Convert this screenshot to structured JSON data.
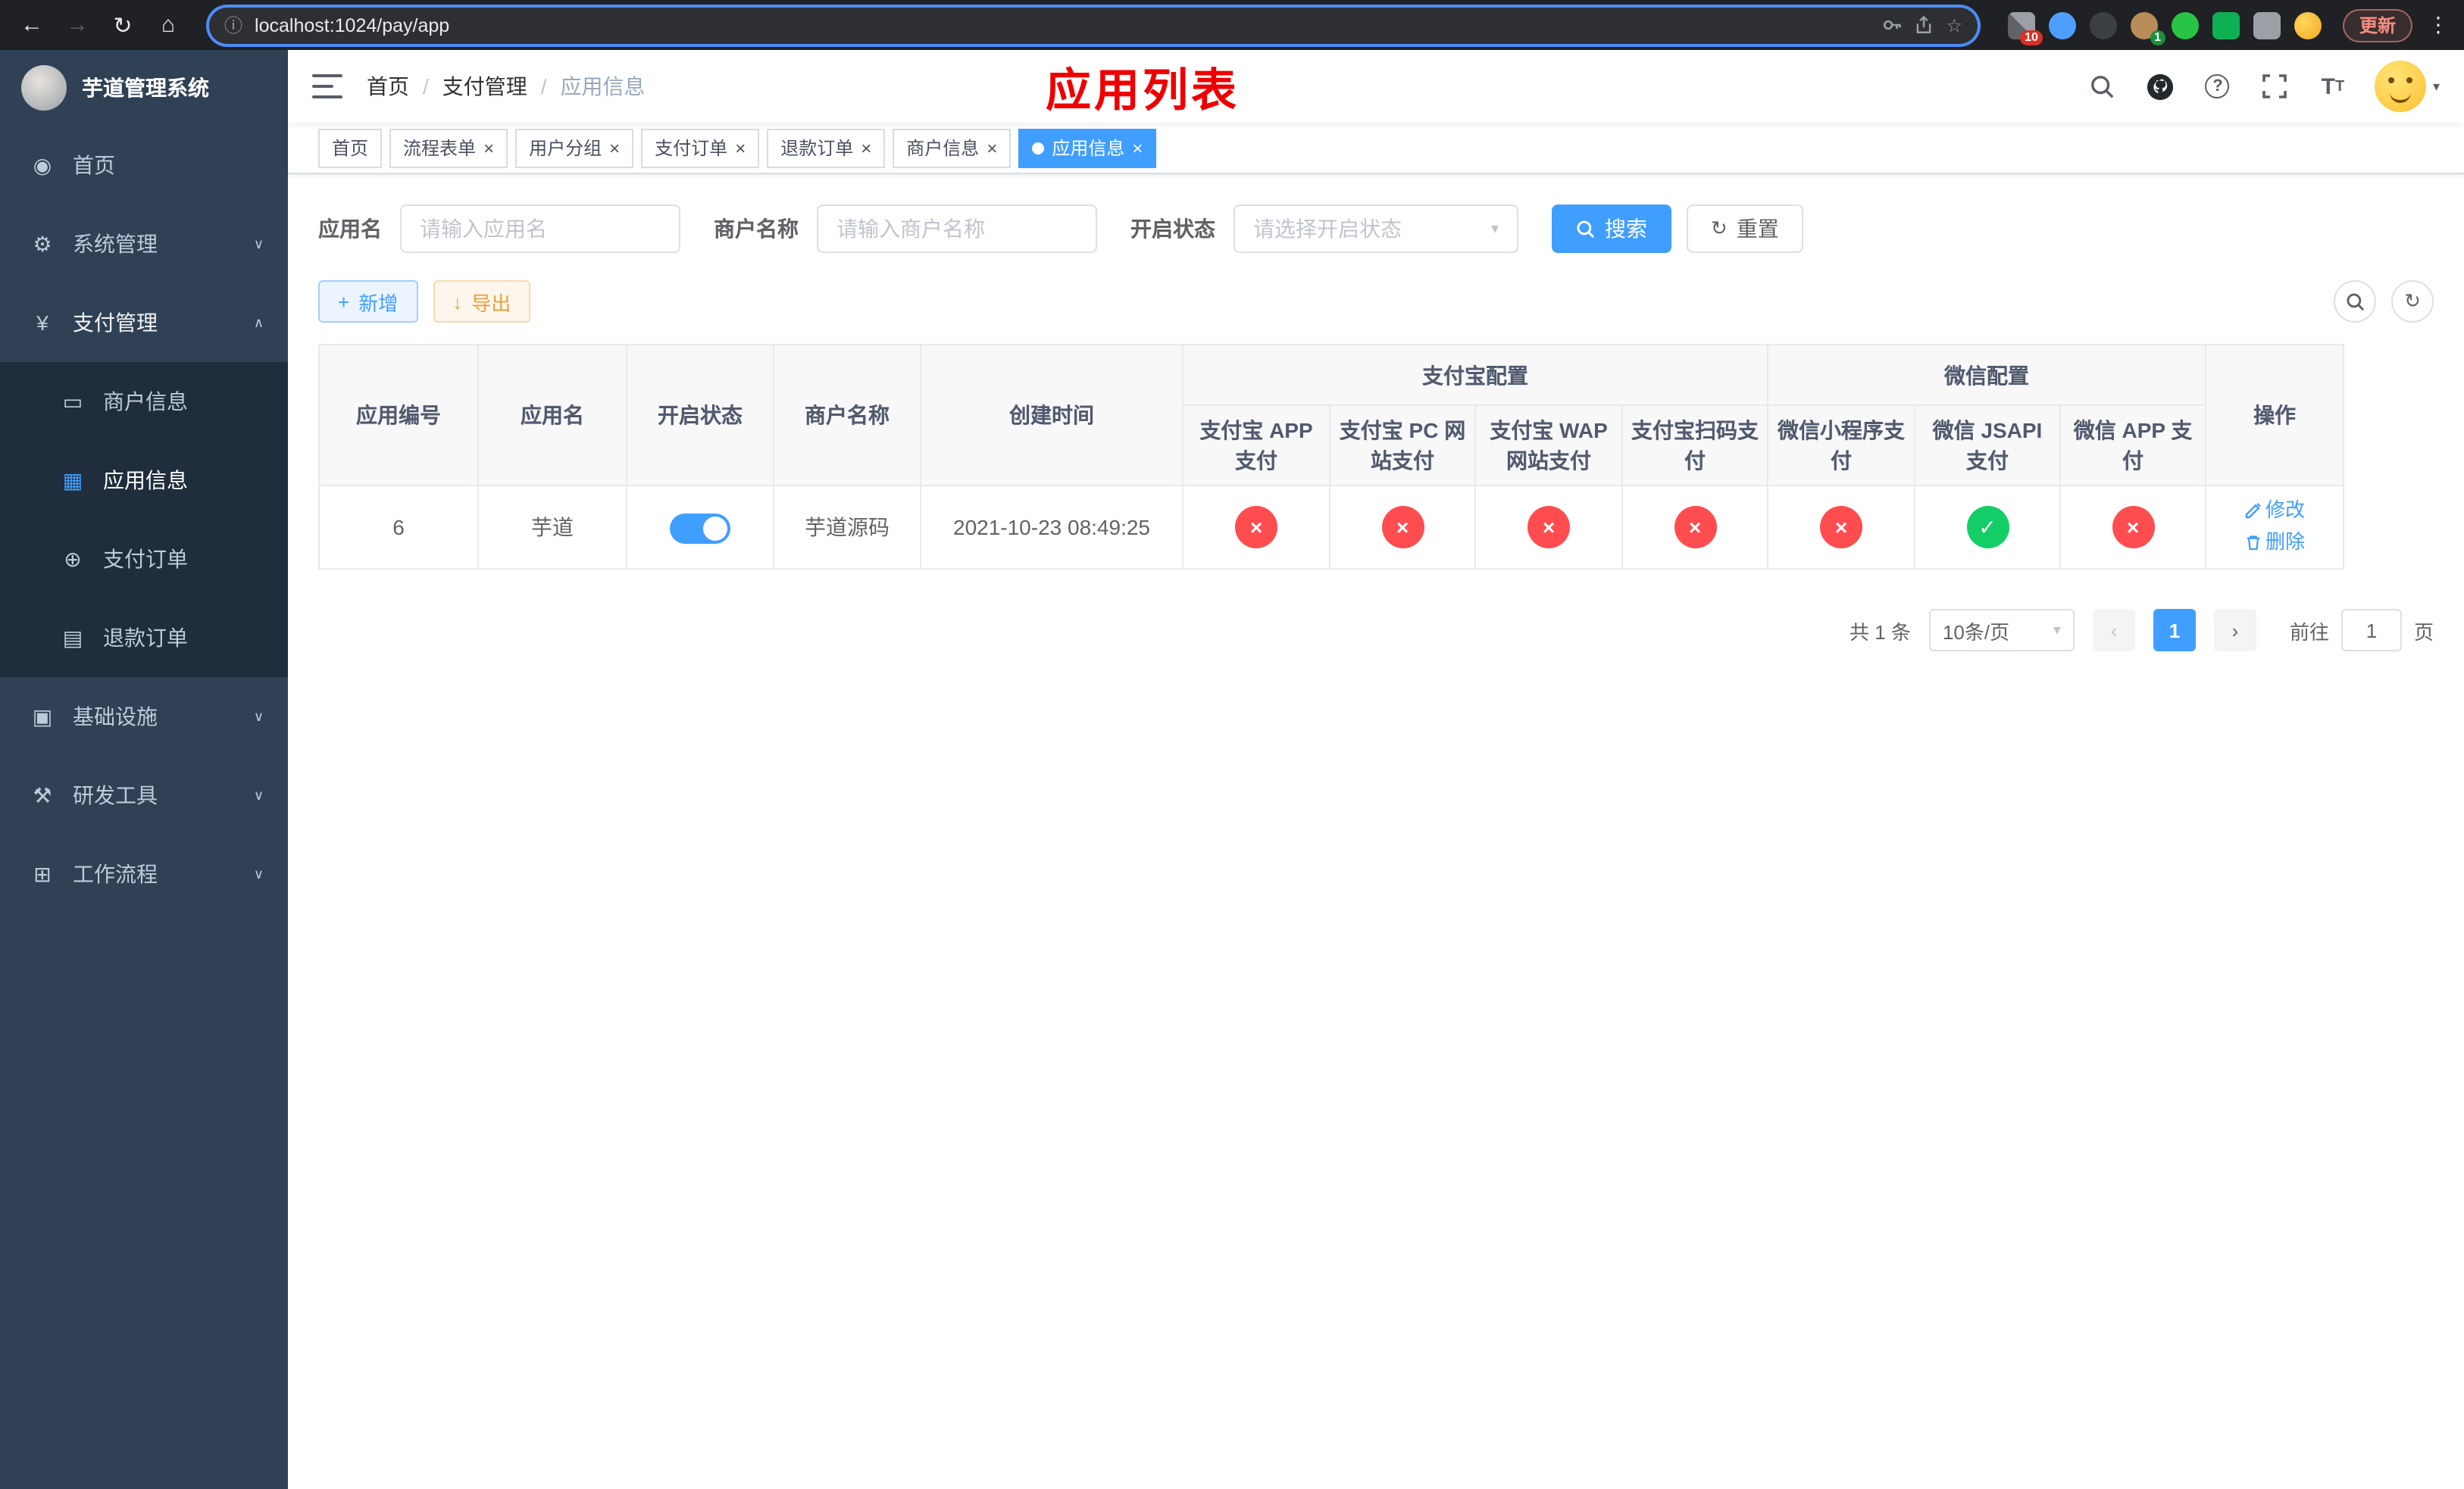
{
  "colors": {
    "accent": "#409eff",
    "success": "#13ce66",
    "danger": "#ff4d4f",
    "warning": "#e6a23c",
    "sidebar_bg": "#304156",
    "submenu_bg": "#1f2d3d",
    "overlay_title_red": "#ee0000",
    "tab_active_bg": "#409eff"
  },
  "browser": {
    "url": "localhost:1024/pay/app",
    "update_label": "更新",
    "ext_badge_blocks": "10",
    "ext_badge_avatar": "1"
  },
  "sidebar": {
    "logo_title": "芋道管理系统",
    "items": [
      {
        "label": "首页",
        "icon": "dashboard-icon"
      },
      {
        "label": "系统管理",
        "icon": "gear-icon",
        "expanded": false
      },
      {
        "label": "支付管理",
        "icon": "yen-icon",
        "expanded": true
      },
      {
        "label": "基础设施",
        "icon": "infra-icon",
        "expanded": false
      },
      {
        "label": "研发工具",
        "icon": "tools-icon",
        "expanded": false
      },
      {
        "label": "工作流程",
        "icon": "workflow-icon",
        "expanded": false
      }
    ],
    "pay_children": [
      {
        "label": "商户信息",
        "icon": "card-icon",
        "active": false
      },
      {
        "label": "应用信息",
        "icon": "grid-icon",
        "active": true
      },
      {
        "label": "支付订单",
        "icon": "order-icon",
        "active": false
      },
      {
        "label": "退款订单",
        "icon": "doc-icon",
        "active": false
      }
    ]
  },
  "header": {
    "breadcrumb": [
      "首页",
      "支付管理",
      "应用信息"
    ],
    "overlay_title": "应用列表"
  },
  "tabs": [
    {
      "label": "首页",
      "closable": false,
      "active": false
    },
    {
      "label": "流程表单",
      "closable": true,
      "active": false
    },
    {
      "label": "用户分组",
      "closable": true,
      "active": false
    },
    {
      "label": "支付订单",
      "closable": true,
      "active": false
    },
    {
      "label": "退款订单",
      "closable": true,
      "active": false
    },
    {
      "label": "商户信息",
      "closable": true,
      "active": false
    },
    {
      "label": "应用信息",
      "closable": true,
      "active": true
    }
  ],
  "filters": {
    "app_name_label": "应用名",
    "app_name_placeholder": "请输入应用名",
    "merchant_label": "商户名称",
    "merchant_placeholder": "请输入商户名称",
    "status_label": "开启状态",
    "status_placeholder": "请选择开启状态",
    "search_button": "搜索",
    "reset_button": "重置"
  },
  "toolbar": {
    "add_button": "新增",
    "export_button": "导出"
  },
  "table": {
    "groups": {
      "alipay": "支付宝配置",
      "wechat": "微信配置"
    },
    "columns": [
      "应用编号",
      "应用名",
      "开启状态",
      "商户名称",
      "创建时间",
      "支付宝 APP 支付",
      "支付宝 PC 网站支付",
      "支付宝 WAP 网站支付",
      "支付宝扫码支付",
      "微信小程序支付",
      "微信 JSAPI 支付",
      "微信 APP 支付",
      "操作"
    ],
    "rows": [
      {
        "id": "6",
        "app_name": "芋道",
        "status_on": true,
        "merchant": "芋道源码",
        "created": "2021-10-23 08:49:25",
        "configs": {
          "alipay_app": false,
          "alipay_pc": false,
          "alipay_wap": false,
          "alipay_qr": false,
          "wx_lite": false,
          "wx_jsapi": true,
          "wx_app": false
        },
        "actions": {
          "edit": "修改",
          "delete": "删除"
        }
      }
    ]
  },
  "pagination": {
    "total": "共 1 条",
    "page_size": "10条/页",
    "current_page": "1",
    "goto_label": "前往",
    "goto_value": "1",
    "goto_unit": "页"
  }
}
